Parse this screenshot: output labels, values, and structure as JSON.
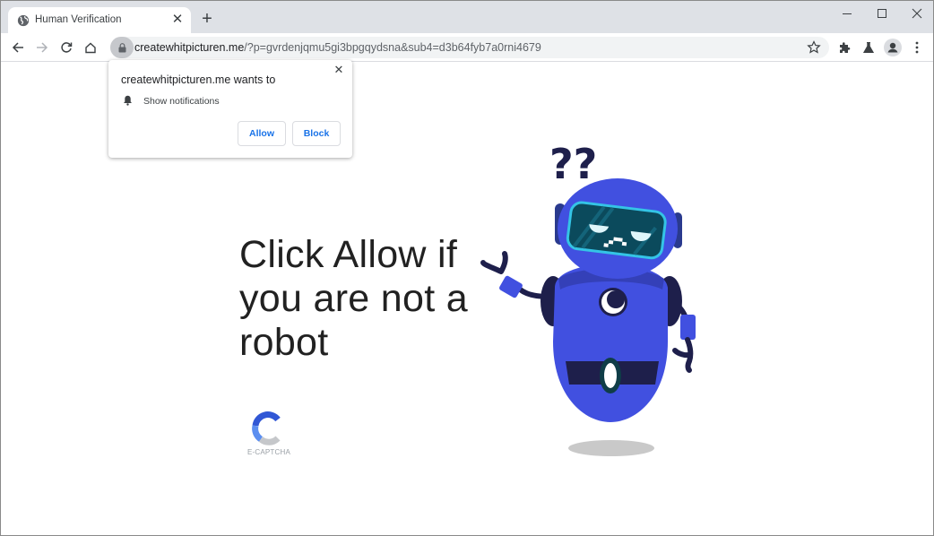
{
  "browser": {
    "tab": {
      "title": "Human Verification",
      "icon": "globe-icon"
    },
    "new_tab_label": "+",
    "window_controls": {
      "minimize": "minimize-icon",
      "maximize": "maximize-icon",
      "close": "close-icon"
    },
    "address_bar": {
      "host": "createwhitpicturen.me",
      "path": "/?p=gvrdenjqmu5gi3bpgqydsna&sub4=d3b64fyb7a0rni4679"
    }
  },
  "permission_popup": {
    "title": "createwhitpicturen.me wants to",
    "permission": "Show notifications",
    "allow_label": "Allow",
    "block_label": "Block",
    "accent_color": "#1a73e8"
  },
  "page": {
    "headline_lines": [
      "Click Allow if",
      "you are not a",
      "robot"
    ],
    "captcha_label": "E-CAPTCHA",
    "robot_question_marks": "??",
    "robot_color": "#4150e0"
  }
}
